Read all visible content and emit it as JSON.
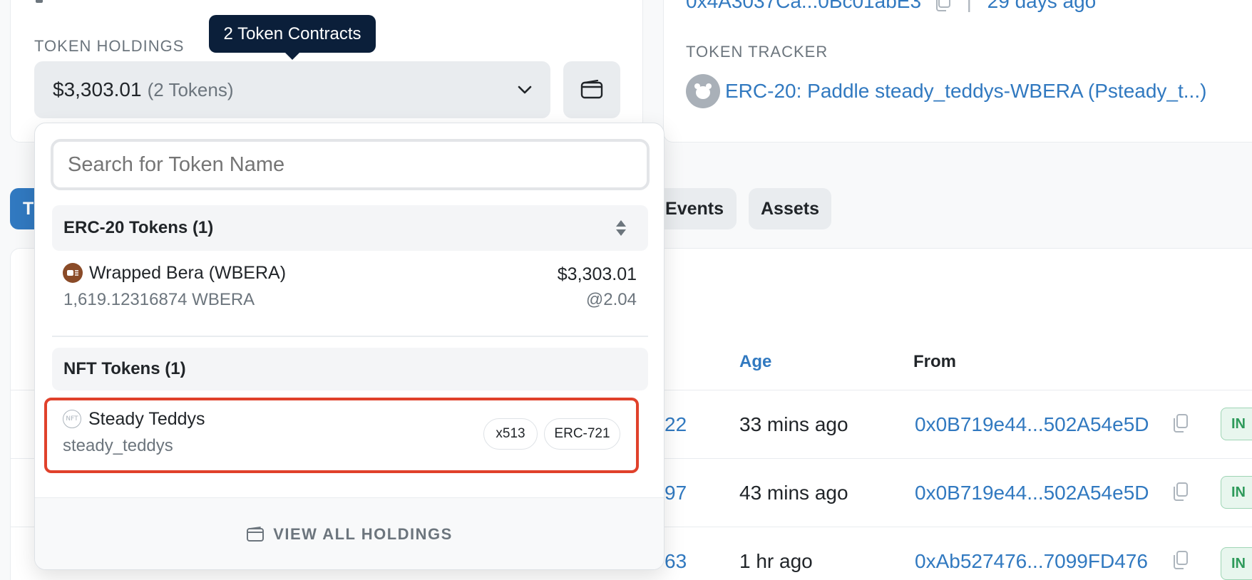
{
  "overview": {
    "token_holdings_label": "TOKEN HOLDINGS",
    "tooltip": "2 Token Contracts",
    "holdings_value": "$3,303.01",
    "holdings_count": "(2 Tokens)"
  },
  "more_info": {
    "creator_address": "0x4A3037Ca...0Bc01abE3",
    "creator_age": "29 days ago",
    "token_tracker_label": "TOKEN TRACKER",
    "token_tracker_value": "ERC-20: Paddle steady_teddys-WBERA (Psteady_t...)"
  },
  "tabs": {
    "first_partial": "T",
    "events": "Events",
    "assets": "Assets"
  },
  "table": {
    "headers": {
      "age": "Age",
      "from": "From"
    },
    "rows": [
      {
        "block_suffix": "22",
        "age": "33 mins ago",
        "from": "0x0B719e44...502A54e5D",
        "direction": "IN"
      },
      {
        "block_suffix": "97",
        "age": "43 mins ago",
        "from": "0x0B719e44...502A54e5D",
        "direction": "IN"
      },
      {
        "block_suffix": "63",
        "age": "1 hr ago",
        "from": "0xAb527476...7099FD476",
        "direction": "IN"
      }
    ]
  },
  "dropdown": {
    "search_placeholder": "Search for Token Name",
    "erc20_header": "ERC-20 Tokens (1)",
    "erc20_token": {
      "name": "Wrapped Bera (WBERA)",
      "balance": "1,619.12316874 WBERA",
      "value": "$3,303.01",
      "price": "@2.04"
    },
    "nft_header": "NFT Tokens (1)",
    "nft_token": {
      "name": "Steady Teddys",
      "symbol": "steady_teddys",
      "count": "x513",
      "standard": "ERC-721"
    },
    "view_all": "VIEW ALL HOLDINGS"
  },
  "colors": {
    "link": "#3179c0",
    "highlight_border": "#e0412b",
    "tooltip_bg": "#0b1f3a",
    "active_tab": "#3179c0"
  }
}
